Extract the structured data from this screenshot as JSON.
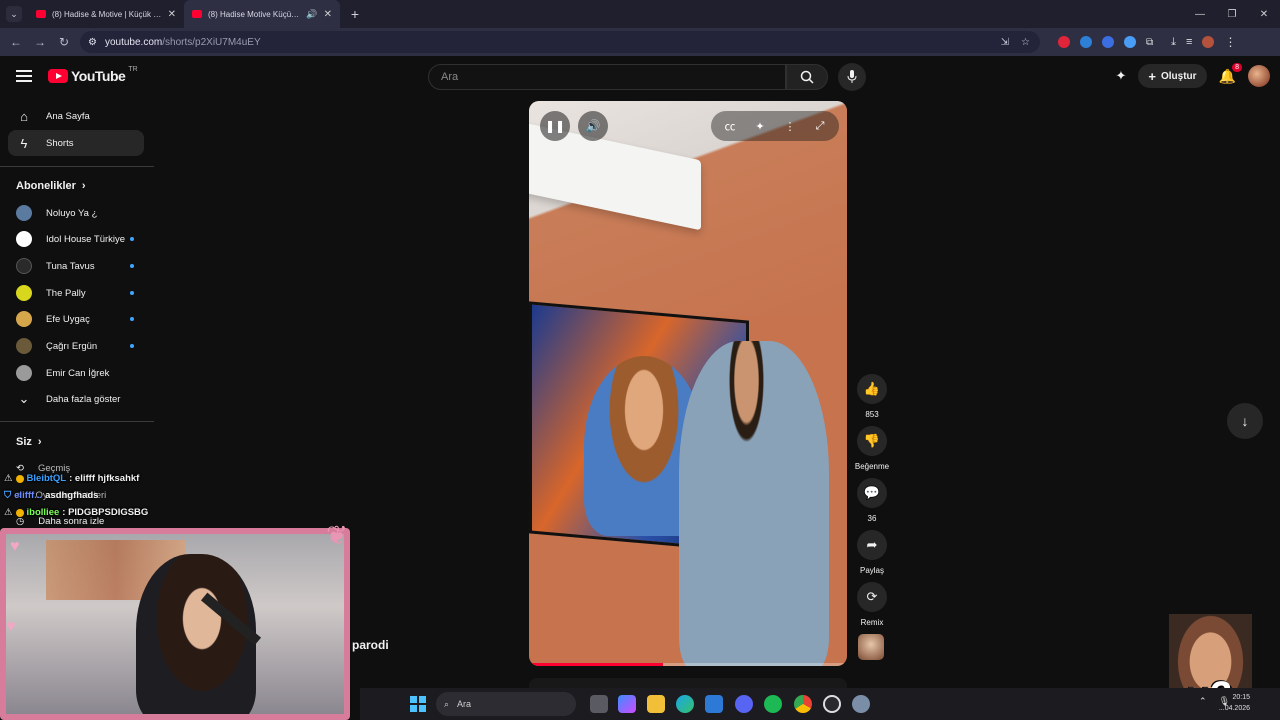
{
  "browser": {
    "tabs": [
      {
        "title": "(8) Hadise & Motive | Küçük Bi..."
      },
      {
        "title": "(8) Hadise Motive Küçük bi..."
      }
    ],
    "url_host": "youtube.com",
    "url_path": "/shorts/p2XiU7M4uEY"
  },
  "youtube": {
    "logo_text": "YouTube",
    "country": "TR",
    "search_placeholder": "Ara",
    "create_label": "Oluştur",
    "notification_count": "8"
  },
  "sidebar": {
    "home": "Ana Sayfa",
    "shorts": "Shorts",
    "subscriptions_header": "Abonelikler",
    "subscriptions": [
      {
        "name": "Noluyo Ya ¿",
        "color": "#5a7aa0"
      },
      {
        "name": "Idol House Türkiye",
        "color": "#ffffff"
      },
      {
        "name": "Tuna Tavus",
        "color": "#2a2a2a"
      },
      {
        "name": "The Pally",
        "color": "#d9d61e"
      },
      {
        "name": "Efe Uygaç",
        "color": "#d6a64a"
      },
      {
        "name": "Çağrı Ergün",
        "color": "#6a5a3a"
      },
      {
        "name": "Emir Can İğrek",
        "color": "#9a9a9a"
      }
    ],
    "show_more": "Daha fazla göster",
    "you_header": "Siz",
    "history": "Geçmiş",
    "playlists": "Oynatma listeleri",
    "watch_later": "Daha sonra izle"
  },
  "actions": {
    "like_count": "853",
    "dislike_label": "Beğenme",
    "comment_count": "36",
    "share_label": "Paylaş",
    "remix_label": "Remix"
  },
  "video": {
    "progress": 0.42
  },
  "stream": {
    "chat": [
      {
        "user": "BleibtQL",
        "message": ": elifff hjfksahkf"
      },
      {
        "user": "elifff...",
        "message": "asdhgfhads"
      },
      {
        "user": "ibolliee",
        "message": ": PIDGBPSDIGSBG"
      }
    ],
    "caption": "parodi",
    "meme_text": "x2"
  },
  "taskbar": {
    "search_placeholder": "Ara",
    "time": "20:15",
    "date": "...04.2026"
  }
}
